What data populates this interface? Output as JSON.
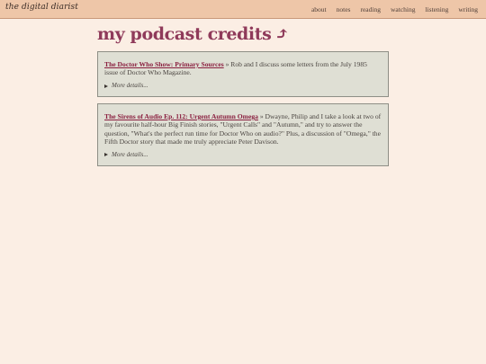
{
  "header": {
    "logo_text": "the digital diarist",
    "nav": [
      "about",
      "notes",
      "reading",
      "watching",
      "listening",
      "writing"
    ]
  },
  "page": {
    "title": "my podcast credits",
    "arrow": "⤴"
  },
  "credits": [
    {
      "link_text": "The Doctor Who Show: Primary Sources",
      "description": " » Rob and I discuss some letters from the July 1985 issue of Doctor Who Magazine.",
      "details_label": "More details..."
    },
    {
      "link_text": "The Sirens of Audio Ep. 112: Urgent Autumn Omega",
      "description": " » Dwayne, Philip and I take a look at two of my favourite half-hour Big Finish stories, \"Urgent Calls\" and \"Autumn,\" and try to answer the question, \"What's the perfect run time for Doctor Who on audio?\" Plus, a discussion of \"Omega,\" the Fifth Doctor story that made me truly appreciate Peter Davison.",
      "details_label": "More details..."
    }
  ],
  "colors": {
    "background": "#fbeee4",
    "header_bar": "#eec6a8",
    "title": "#8f3a5a",
    "link": "#8a1f3f",
    "card_bg": "#dfdfd4",
    "card_border": "#8e8f86"
  }
}
